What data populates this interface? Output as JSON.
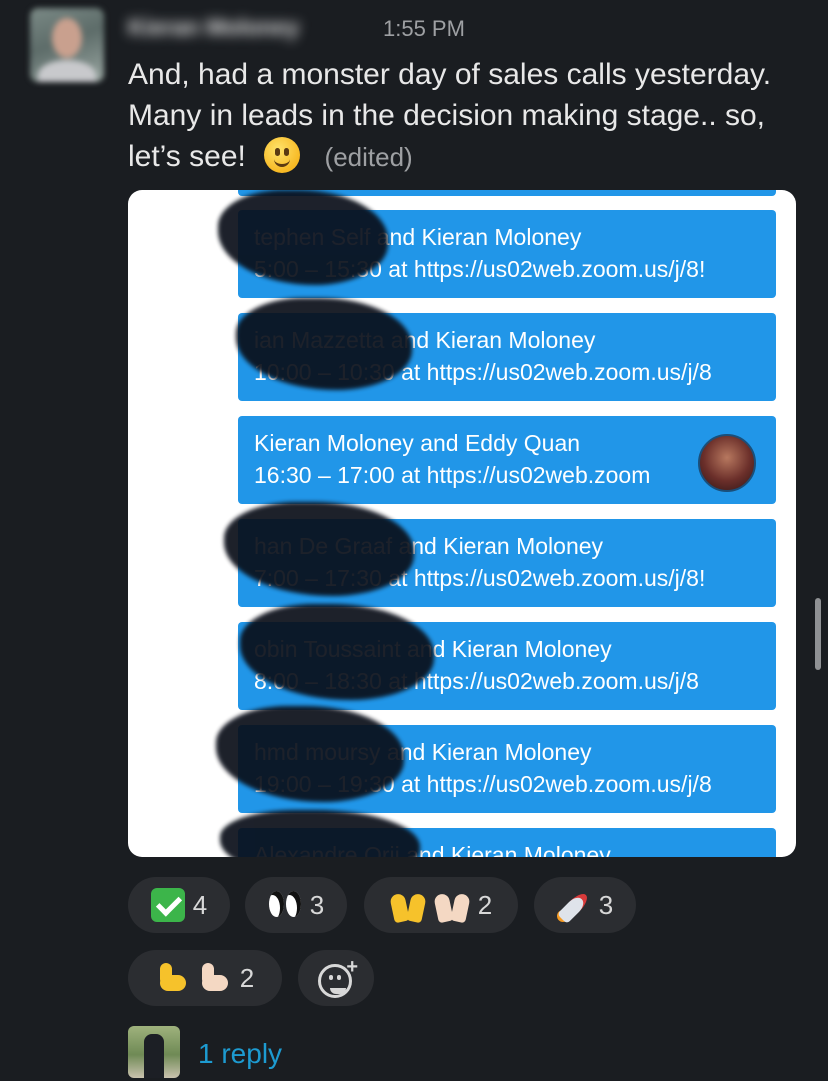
{
  "message": {
    "sender": "Kieran Moloney",
    "time": "1:55 PM",
    "text": "And, had a monster day of sales calls yesterday. Many in leads in the decision making stage.. so, let’s see!",
    "edited": "(edited)",
    "inline_emoji": "slightly-smiling-face"
  },
  "screenshot": {
    "events": [
      {
        "line1": "tephen Self and Kieran Moloney",
        "line2": "5:00 – 15:30 at https://us02web.zoom.us/j/8!"
      },
      {
        "line1": "ian Mazzetta and Kieran Moloney",
        "line2": "10:00 – 10:30 at https://us02web.zoom.us/j/8"
      },
      {
        "line1": "Kieran Moloney and Eddy Quan",
        "line2": "16:30 – 17:00 at https://us02web.zoom"
      },
      {
        "line1": "han De Graaf and Kieran Moloney",
        "line2": "7:00 – 17:30 at https://us02web.zoom.us/j/8!"
      },
      {
        "line1": "obin Toussaint and Kieran Moloney",
        "line2": "8:00 – 18:30 at https://us02web.zoom.us/j/8"
      },
      {
        "line1": "hmd moursy and Kieran Moloney",
        "line2": "19:00 – 19:30 at https://us02web.zoom.us/j/8"
      },
      {
        "line1": "Alexandre Orii and Kieran Moloney",
        "line2": ""
      }
    ]
  },
  "reactions": [
    {
      "emoji": "white-check-mark",
      "count": "4"
    },
    {
      "emoji": "eyes",
      "count": "3"
    },
    {
      "emoji": "raised-hands",
      "count": "2"
    },
    {
      "emoji": "rocket",
      "count": "3"
    },
    {
      "emoji": "flexed-biceps",
      "count": "2"
    }
  ],
  "add_reaction_icon": "add-reaction-icon",
  "thread": {
    "reply_label": "1 reply"
  }
}
